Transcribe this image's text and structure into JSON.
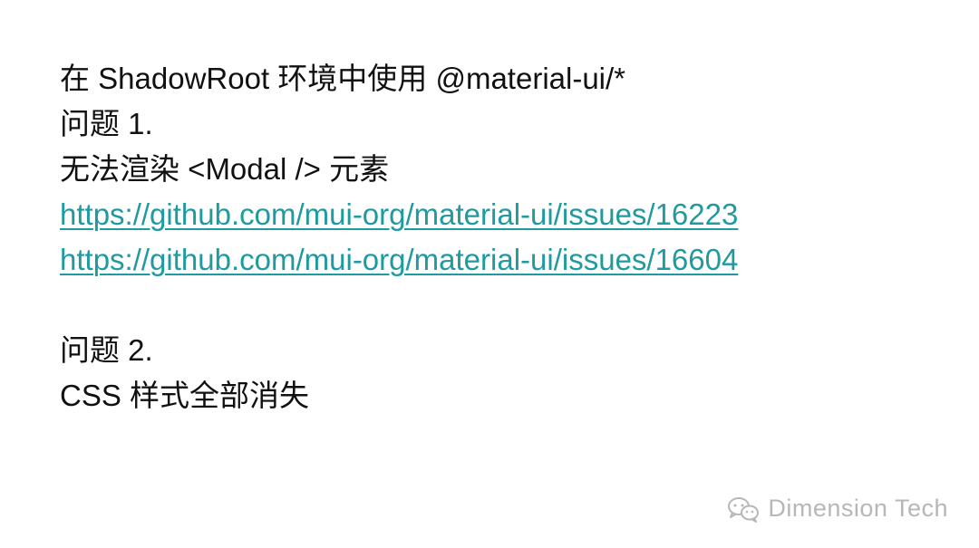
{
  "lines": {
    "l1": "在 ShadowRoot 环境中使用 @material-ui/*",
    "l2": "问题 1.",
    "l3": "无法渲染 <Modal /> 元素",
    "link1": "https://github.com/mui-org/material-ui/issues/16223",
    "link2": "https://github.com/mui-org/material-ui/issues/16604",
    "l4": "问题 2.",
    "l5": "CSS 样式全部消失"
  },
  "watermark": {
    "text": "Dimension Tech",
    "icon": "wechat-icon",
    "color": "#b7b7b7"
  },
  "colors": {
    "text": "#111111",
    "link": "#1f9aa0",
    "background": "#ffffff"
  }
}
